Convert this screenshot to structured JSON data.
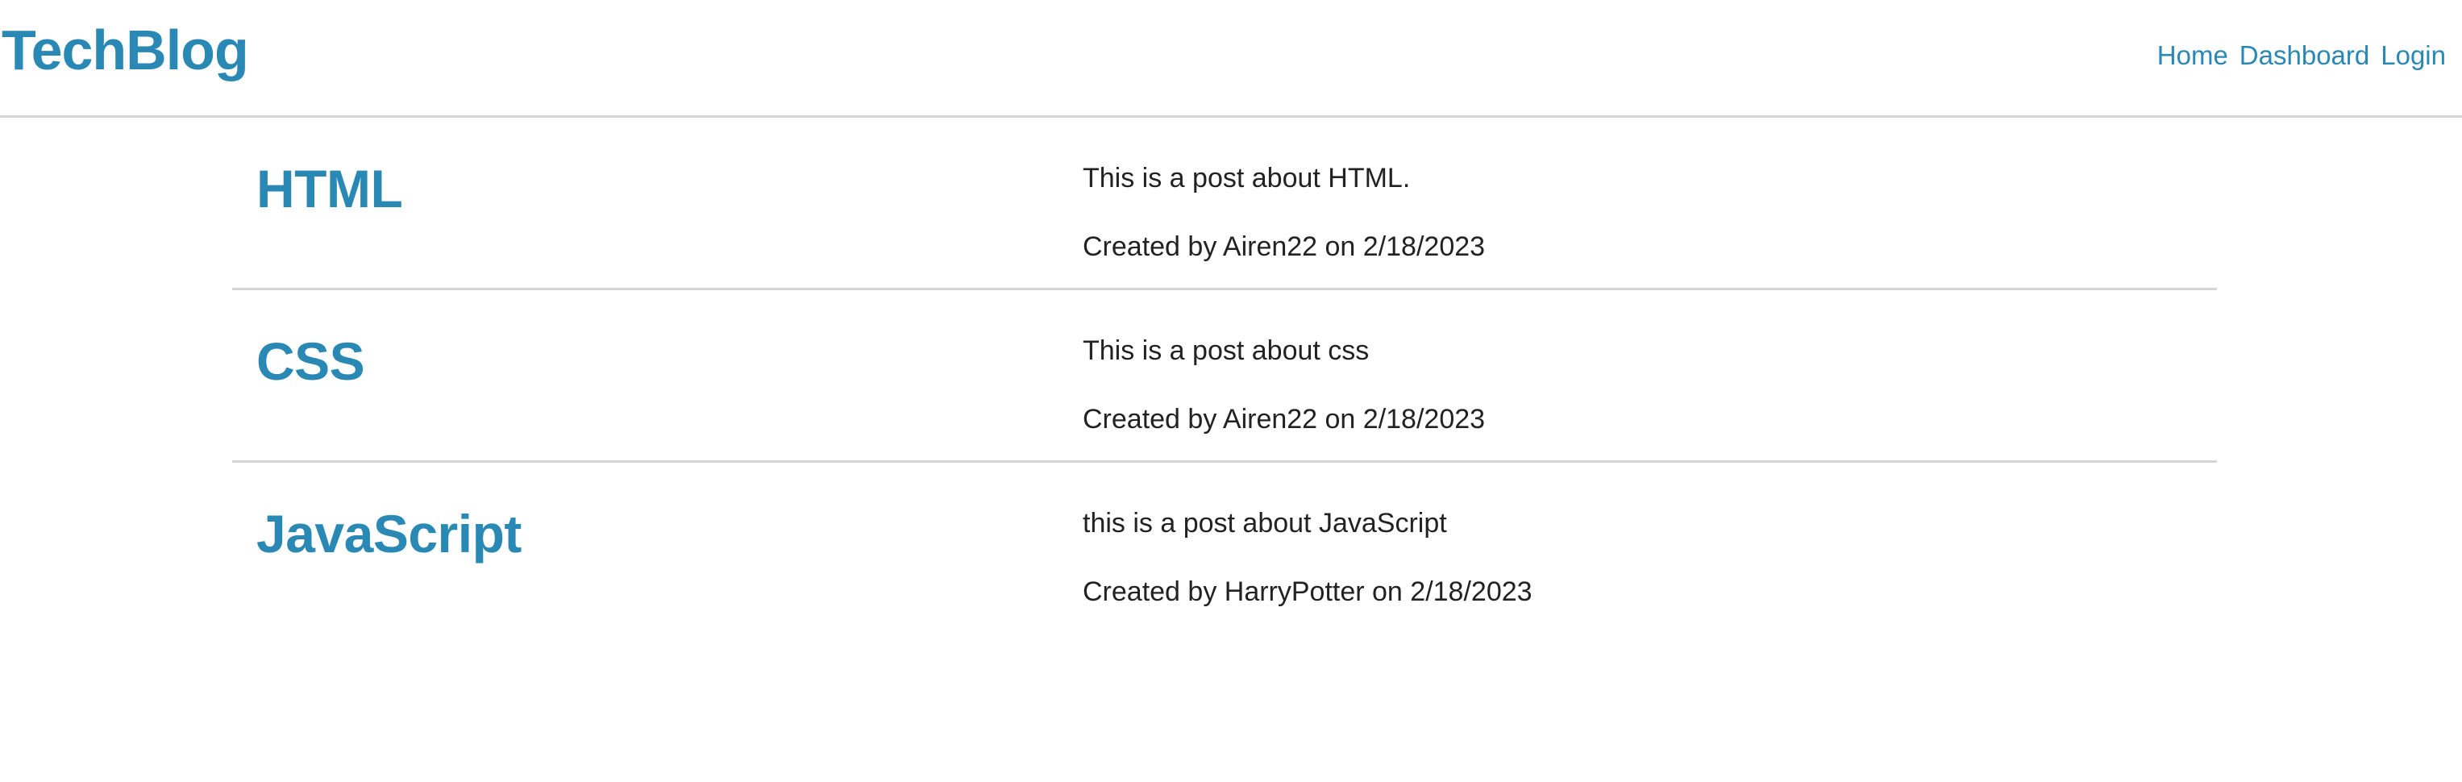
{
  "header": {
    "brand": "TechBlog",
    "nav": {
      "home": "Home",
      "dashboard": "Dashboard",
      "login": "Login"
    }
  },
  "posts": [
    {
      "title": "HTML",
      "body": "This is a post about HTML.",
      "meta": "Created by Airen22 on 2/18/2023"
    },
    {
      "title": "CSS",
      "body": "This is a post about css",
      "meta": "Created by Airen22 on 2/18/2023"
    },
    {
      "title": "JavaScript",
      "body": "this is a post about JavaScript",
      "meta": "Created by HarryPotter on 2/18/2023"
    }
  ],
  "colors": {
    "accent": "#2a88b5",
    "text": "#222222",
    "divider": "#d5d5d5"
  }
}
